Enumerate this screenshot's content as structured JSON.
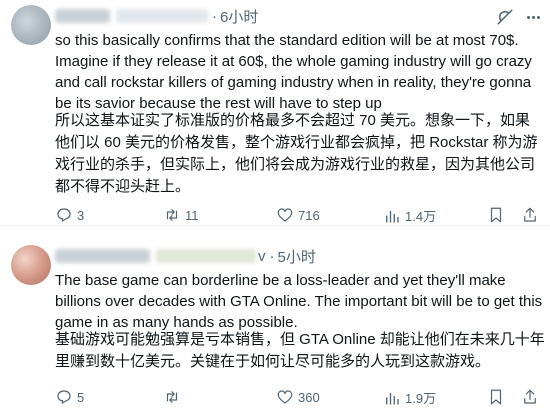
{
  "tweets": [
    {
      "author": {
        "name": "",
        "handle": ""
      },
      "time": "6小时",
      "text_en": "so this basically confirms that the standard edition will be at most 70$. Imagine if they release it at 60$, the whole gaming industry will go crazy and call rockstar killers of gaming industry when in reality, they're gonna be its savior because the rest will have to step up",
      "text_zh": "所以这基本证实了标准版的价格最多不会超过 70 美元。想象一下，如果他们以 60 美元的价格发售，整个游戏行业都会疯掉，把 Rockstar 称为游戏行业的杀手，但实际上，他们将会成为游戏行业的救星，因为其他公司都不得不迎头赶上。",
      "actions": {
        "replies": "3",
        "reposts": "11",
        "likes": "716",
        "views": "1.4万"
      }
    },
    {
      "author": {
        "name": "",
        "handle": "v"
      },
      "time": "5小时",
      "text_en": "The base game can borderline be a loss-leader and yet they'll make billions over decades with GTA Online. The important bit will be to get this game in as many hands as possible.",
      "text_zh": "基础游戏可能勉强算是亏本销售，但 GTA Online 却能让他们在未来几十年里赚到数十亿美元。关键在于如何让尽可能多的人玩到这款游戏。",
      "actions": {
        "replies": "5",
        "reposts": "",
        "likes": "360",
        "views": "1.9万"
      }
    }
  ],
  "separator_dot": "·",
  "colors": {
    "text": "#0f1419",
    "secondary": "#536471",
    "divider": "#eff3f4"
  }
}
